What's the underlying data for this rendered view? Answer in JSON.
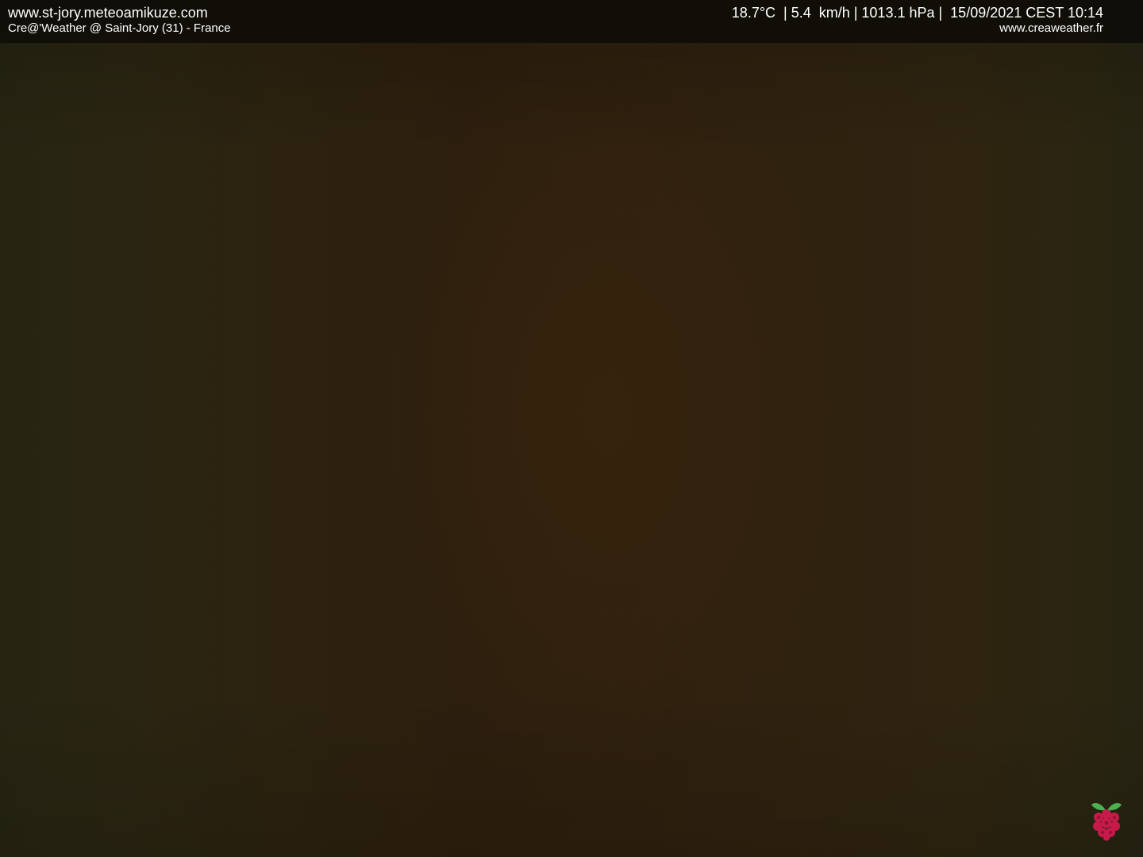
{
  "overlay": {
    "site_url": "www.st-jory.meteoamikuze.com",
    "station": "Cre@'Weather @ Saint-Jory (31) - France",
    "readouts": "18.7°C  | 5.4  km/h | 1013.1 hPa |  15/09/2021 CEST 10:14",
    "brand_url": "www.creaweather.fr"
  },
  "logo": {
    "icon": "raspberry-pi-logo-icon"
  },
  "colors": {
    "overlay_text": "#ffffff",
    "logo_leaf": "#4caf50",
    "logo_berry": "#c51a4a"
  }
}
